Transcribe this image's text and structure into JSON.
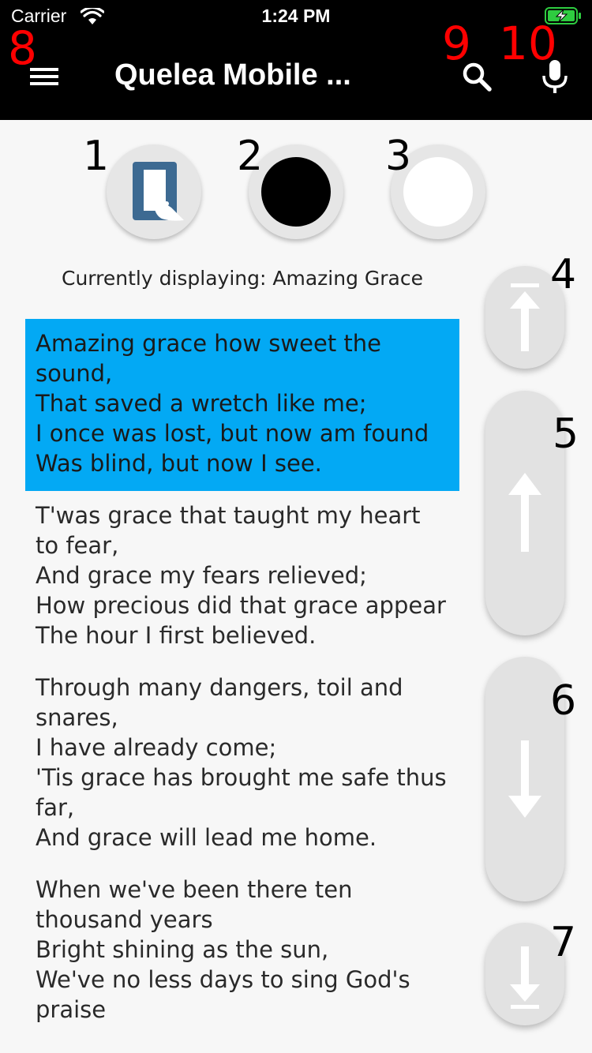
{
  "status": {
    "carrier": "Carrier",
    "time": "1:24 PM"
  },
  "appbar": {
    "title": "Quelea Mobile ..."
  },
  "annotations": {
    "n1": "1",
    "n2": "2",
    "n3": "3",
    "n4": "4",
    "n5": "5",
    "n6": "6",
    "n7": "7",
    "n8": "8",
    "n9": "9",
    "n10": "10"
  },
  "mode_buttons": [
    {
      "icon": "quelea-logo-icon"
    },
    {
      "icon": "black-circle-icon",
      "color": "#000000"
    },
    {
      "icon": "white-circle-icon",
      "color": "#ffffff"
    }
  ],
  "currently_displaying": "Currently displaying: Amazing Grace",
  "verses": [
    "Amazing grace how sweet the sound,\nThat saved a wretch like me;\nI once was lost, but now am found\nWas blind, but now I see.",
    "T'was grace that taught my heart to fear,\nAnd grace my fears relieved;\nHow precious did that grace appear\nThe hour I first believed.",
    "Through many dangers, toil and snares,\nI have already come;\n'Tis grace has brought me safe thus far,\nAnd grace will lead me home.",
    "When we've been there ten thousand years\nBright shining as the sun,\nWe've no less days to sing God's praise"
  ],
  "side_buttons": [
    {
      "icon": "arrow-to-top-icon"
    },
    {
      "icon": "arrow-up-icon"
    },
    {
      "icon": "arrow-down-icon"
    },
    {
      "icon": "arrow-to-bottom-icon"
    }
  ],
  "colors": {
    "highlight": "#03a9f4",
    "appbar": "#000000",
    "badge": "#ff0000"
  }
}
